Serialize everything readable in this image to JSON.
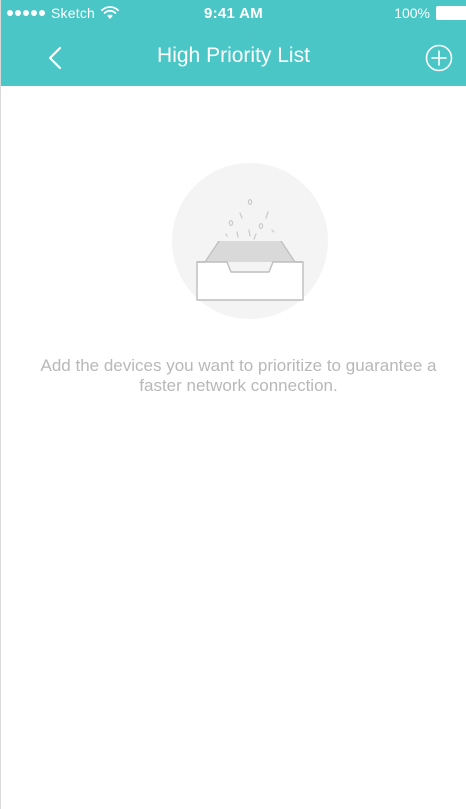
{
  "status_bar": {
    "carrier": "Sketch",
    "time": "9:41 AM",
    "battery": "100%"
  },
  "navbar": {
    "title": "High Priority List",
    "back_icon": "chevron-left-icon",
    "add_icon": "plus-circle-icon"
  },
  "empty_state": {
    "message": "Add the devices you want to prioritize to guarantee a faster network connection.",
    "illustration_icon": "empty-tray-icon"
  },
  "colors": {
    "accent": "#4ac6c6",
    "background": "#ffffff",
    "text_muted": "#b8b8b8"
  }
}
